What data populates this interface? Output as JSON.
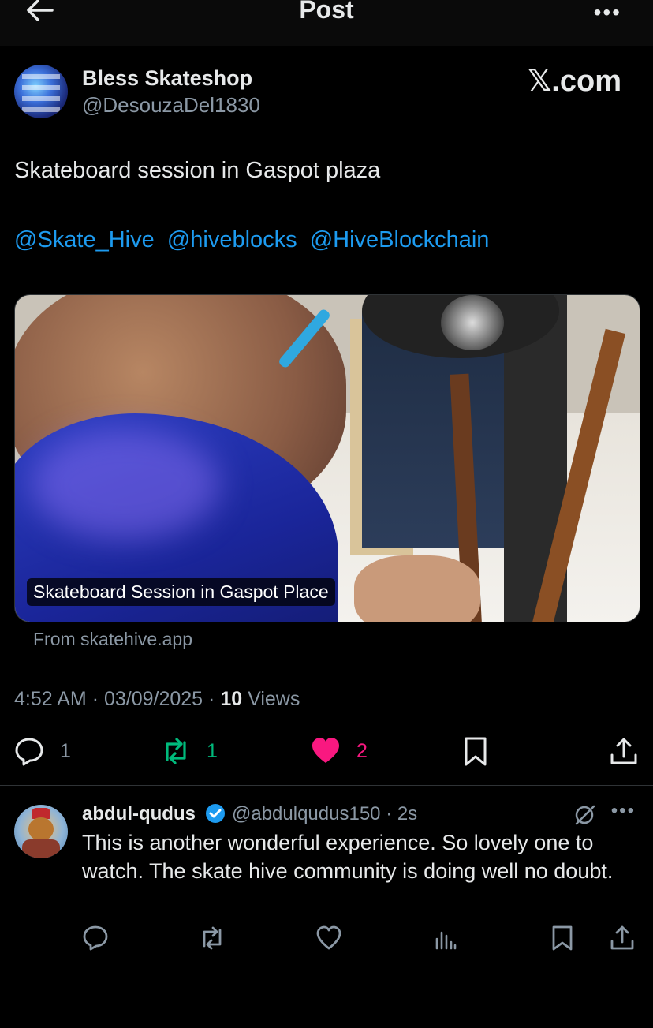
{
  "header": {
    "title": "Post"
  },
  "post": {
    "author_name": "Bless Skateshop",
    "author_handle": "@DesouzaDel1830",
    "watermark": "𝕏.com",
    "text": "Skateboard session in Gaspot plaza",
    "mentions": [
      "@Skate_Hive",
      "@hiveblocks",
      "@HiveBlockchain"
    ],
    "media_caption": "Skateboard Session in Gaspot Place",
    "source": "From skatehive.app",
    "time": "4:52 AM",
    "date": "03/09/2025",
    "views_count": "10",
    "views_label": "Views",
    "replies": "1",
    "reposts": "1",
    "likes": "2"
  },
  "reply": {
    "author_name": "abdul-qudus",
    "author_handle": "@abdulqudus150",
    "time": "2s",
    "text": "This is another wonderful experience. So lovely one to watch. The skate hive community is doing well no doubt."
  },
  "colors": {
    "background": "#000000",
    "link": "#1d9bf0",
    "repost": "#00ba7c",
    "like": "#f91880",
    "muted": "#8b98a5"
  },
  "icons": [
    "back-arrow-icon",
    "more-icon",
    "reply-icon",
    "repost-icon",
    "heart-icon",
    "bookmark-icon",
    "share-icon",
    "verified-icon",
    "grok-icon",
    "analytics-icon"
  ]
}
